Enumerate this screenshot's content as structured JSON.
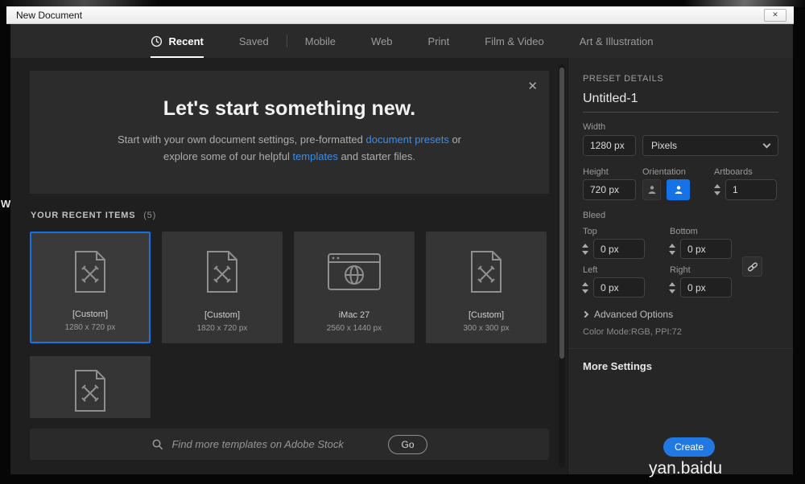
{
  "window": {
    "title": "New Document",
    "close_glyph": "✕"
  },
  "tabs": [
    {
      "label": "Recent"
    },
    {
      "label": "Saved"
    },
    {
      "label": "Mobile"
    },
    {
      "label": "Web"
    },
    {
      "label": "Print"
    },
    {
      "label": "Film & Video"
    },
    {
      "label": "Art & Illustration"
    }
  ],
  "hero": {
    "title": "Let's start something new.",
    "line1_pre": "Start with your own document settings, pre-formatted ",
    "link_presets": "document presets",
    "line1_post": " or",
    "line2_pre": "explore some of our helpful ",
    "link_templates": "templates",
    "line2_post": " and starter files.",
    "close_glyph": "✕"
  },
  "recent": {
    "heading": "YOUR RECENT ITEMS",
    "count": "(5)",
    "items": [
      {
        "name": "[Custom]",
        "dims": "1280 x 720 px"
      },
      {
        "name": "[Custom]",
        "dims": "1820 x 720 px"
      },
      {
        "name": "iMac 27",
        "dims": "2560 x 1440 px"
      },
      {
        "name": "[Custom]",
        "dims": "300 x 300 px"
      }
    ]
  },
  "search": {
    "placeholder": "Find more templates on Adobe Stock",
    "go_label": "Go"
  },
  "preset": {
    "heading": "PRESET DETAILS",
    "doc_name": "Untitled-1",
    "width_label": "Width",
    "width_value": "1280 px",
    "units_value": "Pixels",
    "height_label": "Height",
    "height_value": "720 px",
    "orientation_label": "Orientation",
    "artboards_label": "Artboards",
    "artboards_value": "1",
    "bleed_label": "Bleed",
    "top_label": "Top",
    "top_value": "0 px",
    "bottom_label": "Bottom",
    "bottom_value": "0 px",
    "left_label": "Left",
    "left_value": "0 px",
    "right_label": "Right",
    "right_value": "0 px",
    "advanced_label": "Advanced Options",
    "color_mode": "Color Mode:RGB, PPI:72",
    "more_settings_label": "More Settings",
    "create_label": "Create"
  },
  "watermark": "yan.baidu",
  "background": {
    "letter": "W"
  },
  "colors": {
    "accent": "#1473e6",
    "link": "#3d8ce8"
  }
}
